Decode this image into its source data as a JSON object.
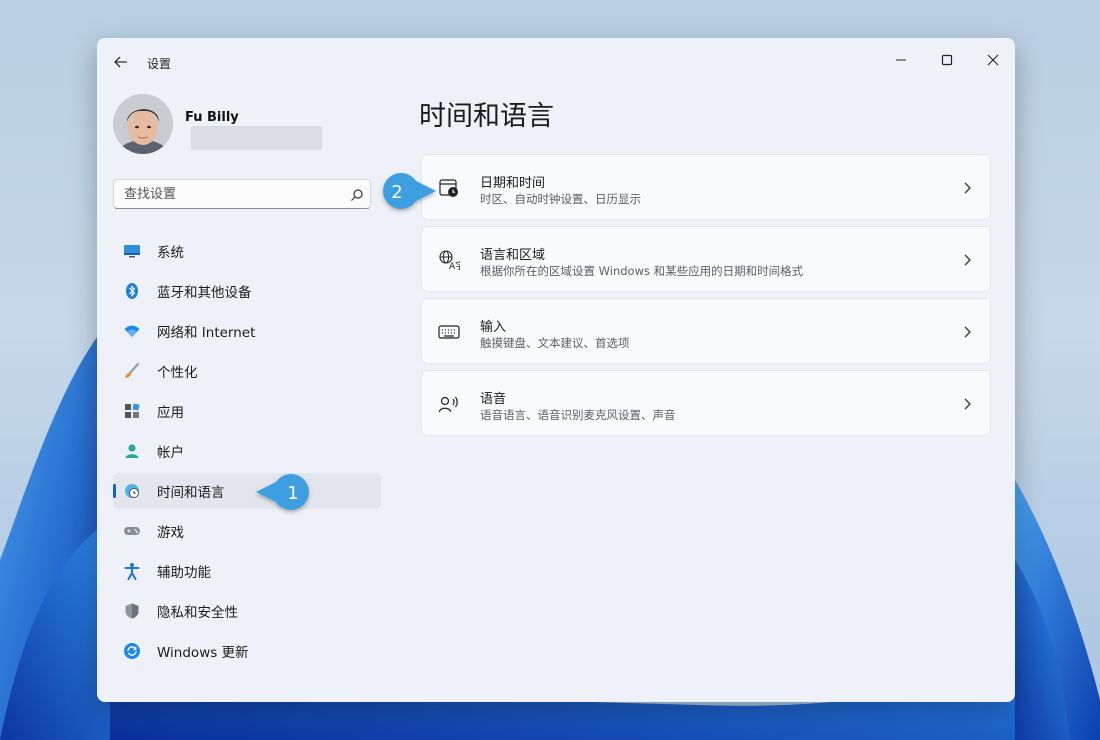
{
  "window": {
    "title": "设置"
  },
  "profile": {
    "name": "Fu Billy"
  },
  "search": {
    "placeholder": "查找设置"
  },
  "sidebar": {
    "items": [
      {
        "label": "系统",
        "icon": "monitor-icon"
      },
      {
        "label": "蓝牙和其他设备",
        "icon": "bluetooth-icon"
      },
      {
        "label": "网络和 Internet",
        "icon": "wifi-icon"
      },
      {
        "label": "个性化",
        "icon": "brush-icon"
      },
      {
        "label": "应用",
        "icon": "apps-icon"
      },
      {
        "label": "帐户",
        "icon": "person-icon"
      },
      {
        "label": "时间和语言",
        "icon": "globe-clock-icon",
        "active": true
      },
      {
        "label": "游戏",
        "icon": "gamepad-icon"
      },
      {
        "label": "辅助功能",
        "icon": "accessibility-icon"
      },
      {
        "label": "隐私和安全性",
        "icon": "shield-icon"
      },
      {
        "label": "Windows 更新",
        "icon": "update-icon"
      }
    ]
  },
  "main": {
    "title": "时间和语言",
    "cards": [
      {
        "title": "日期和时间",
        "description": "时区、自动时钟设置、日历显示",
        "icon": "calendar-clock-icon"
      },
      {
        "title": "语言和区域",
        "description": "根据你所在的区域设置 Windows 和某些应用的日期和时间格式",
        "icon": "language-icon"
      },
      {
        "title": "输入",
        "description": "触摸键盘、文本建议、首选项",
        "icon": "keyboard-icon"
      },
      {
        "title": "语音",
        "description": "语音语言、语音识别麦克风设置、声音",
        "icon": "speech-icon"
      }
    ]
  },
  "callouts": [
    {
      "number": "1",
      "target": "时间和语言"
    },
    {
      "number": "2",
      "target": "日期和时间"
    }
  ],
  "colors": {
    "accent": "#1565c0",
    "callout": "#3d9fe0",
    "window_bg": "#eef1f7",
    "card_bg": "#f9fafc"
  }
}
